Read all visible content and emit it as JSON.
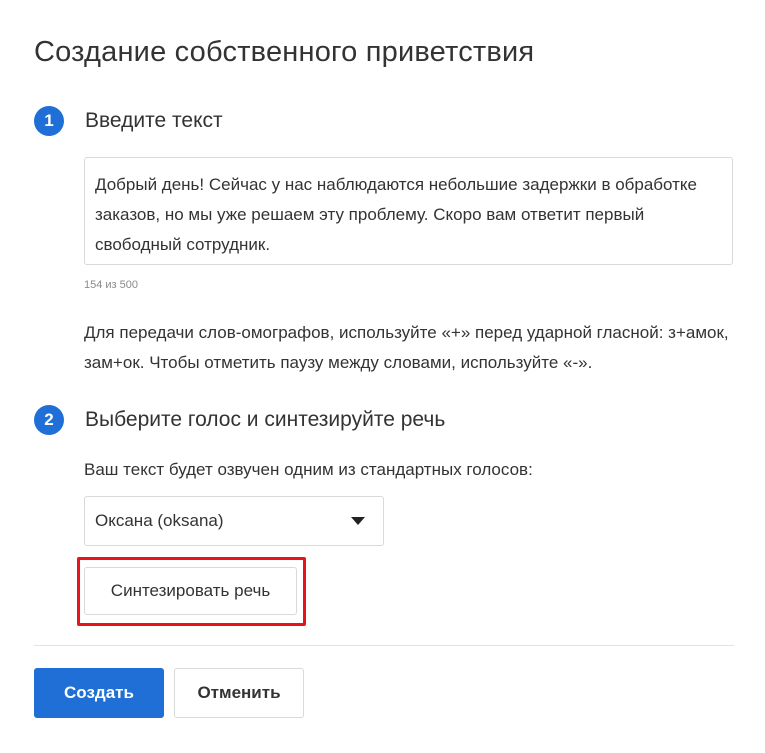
{
  "page_title": "Создание собственного приветствия",
  "step1": {
    "number": "1",
    "title": "Введите текст",
    "text_value": "Добрый день! Сейчас у нас наблюдаются небольшие задержки в обработке заказов, но мы уже решаем эту проблему. Скоро вам ответит первый свободный сотрудник.",
    "counter": "154 из 500",
    "hint": "Для передачи слов-омографов, используйте «+» перед ударной гласной: з+амок, зам+ок. Чтобы отметить паузу между словами, используйте «-»."
  },
  "step2": {
    "number": "2",
    "title": "Выберите голос и синтезируйте речь",
    "voice_label": "Ваш текст будет озвучен одним из стандартных голосов:",
    "voice_selected": "Оксана (oksana)",
    "synth_button": "Синтезировать речь"
  },
  "footer": {
    "create_button": "Создать",
    "cancel_button": "Отменить"
  },
  "colors": {
    "accent": "#1f6fd6",
    "highlight": "#e8141b"
  },
  "icons": {
    "select_caret": "caret-down-icon"
  }
}
